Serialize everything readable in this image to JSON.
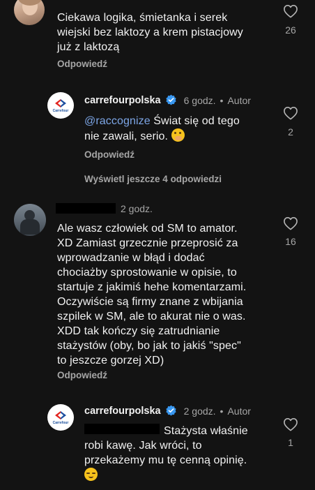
{
  "comment1": {
    "text_lines": [
      "Ciekawa logika, śmietanka i serek",
      "wiejski bez laktozy a krem pistacjowy",
      "już z laktozą"
    ],
    "reply_label": "Odpowiedź",
    "like_count": "26"
  },
  "reply1": {
    "username": "carrefourpolska",
    "time": "6 godz.",
    "separator": "•",
    "author_label": "Autor",
    "mention": "@raccognize",
    "text_line1": " Świat się od tego",
    "text_line2": "nie zawali, serio. ",
    "reply_label": "Odpowiedź",
    "like_count": "2",
    "logo_text": "Carrefour"
  },
  "view_more": "Wyświetl jeszcze 4 odpowiedzi",
  "comment2": {
    "time": "2 godz.",
    "text_lines": [
      "Ale wasz człowiek od SM to amator.",
      "XD Zamiast grzecznie przeprosić za",
      "wprowadzanie w błąd i dodać",
      "chociażby sprostowanie w opisie, to",
      "startuje z jakimiś hehe komentarzami.",
      "Oczywiście są firmy znane z wbijania",
      "szpilek w SM, ale to akurat nie o was.",
      "XDD tak kończy się zatrudnianie",
      "stażystów (oby, bo jak to jakiś \"spec\"",
      "to jeszcze gorzej XD)"
    ],
    "reply_label": "Odpowiedź",
    "like_count": "16"
  },
  "reply2": {
    "username": "carrefourpolska",
    "time": "2 godz.",
    "separator": "•",
    "author_label": "Autor",
    "text_line1": "Stażysta właśnie",
    "text_line2": "robi kawę. Jak wróci, to",
    "text_line3": "przekażemy mu tę cenną opinię.",
    "like_count": "1",
    "logo_text": "Carrefour"
  }
}
